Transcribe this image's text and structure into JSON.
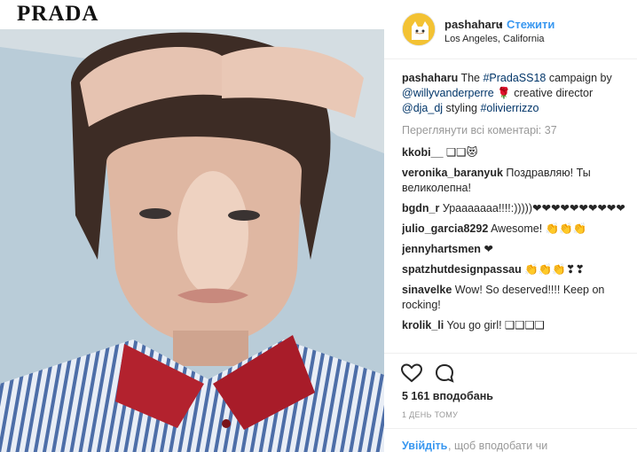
{
  "image": {
    "brand": "PRADA"
  },
  "header": {
    "username": "pashaharu",
    "separator": "•",
    "follow_label": "Стежити",
    "location": "Los Angeles, California"
  },
  "caption": {
    "username": "pashaharu",
    "text_1": " The ",
    "tag_1": "#PradaSS18",
    "text_2": " campaign by ",
    "mention_1": "@willyvanderperre",
    "text_3": " 🌹 creative director ",
    "mention_2": "@dja_dj",
    "text_4": " styling ",
    "tag_2": "#olivierrizzo"
  },
  "view_all_comments": "Переглянути всі коментарі: 37",
  "comments": [
    {
      "user": "kkobi__",
      "text": " ❑❑😻"
    },
    {
      "user": "veronika_baranyuk",
      "text": " Поздравляю! Ты великолепна!"
    },
    {
      "user": "bgdn_r",
      "text": " Урааааааа!!!!:)))))❤❤❤❤❤❤❤❤❤❤"
    },
    {
      "user": "julio_garcia8292",
      "text": " Awesome! 👏👏👏"
    },
    {
      "user": "jennyhartsmen",
      "text": " ❤"
    },
    {
      "user": "spatzhutdesignpassau",
      "text": " 👏👏👏❣❣"
    },
    {
      "user": "sinavelke",
      "text": " Wow! So deserved!!!! Keep on rocking!"
    },
    {
      "user": "krolik_li",
      "text": " You go girl! ❑❑❑❑"
    }
  ],
  "icons": {
    "like": "heart-icon",
    "comment": "comment-icon"
  },
  "likes": "5 161 вподобань",
  "time": "1 ДЕНЬ ТОМУ",
  "login": {
    "link": "Увійдіть",
    "rest": ", щоб вподобати чи"
  }
}
